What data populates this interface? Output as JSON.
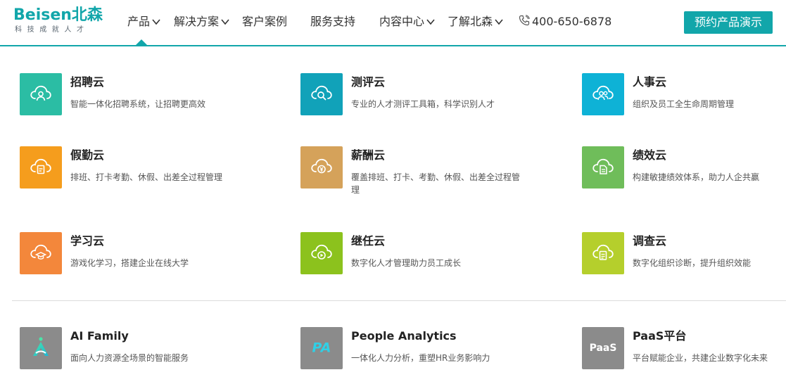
{
  "brand": {
    "logo_word": "Beisen北森",
    "logo_tagline": "科技成就人才",
    "accent_color": "#12a6aa"
  },
  "nav": {
    "items": [
      {
        "label": "产品",
        "dropdown": true
      },
      {
        "label": "解决方案",
        "dropdown": true
      },
      {
        "label": "客户案例",
        "dropdown": false
      },
      {
        "label": "服务支持",
        "dropdown": false
      },
      {
        "label": "内容中心",
        "dropdown": true
      },
      {
        "label": "了解北森",
        "dropdown": true
      }
    ],
    "phone": "400-650-6878",
    "phone_icon": "phone-icon",
    "demo_button": "预约产品演示"
  },
  "products": [
    {
      "name": "招聘云",
      "desc": "智能一体化招聘系统，让招聘更高效",
      "color": "#2bbda4",
      "icon": "cloud-person-icon"
    },
    {
      "name": "测评云",
      "desc": "专业的人才测评工具箱，科学识别人才",
      "color": "#11a2b9",
      "icon": "cloud-search-icon"
    },
    {
      "name": "人事云",
      "desc": "组织及员工全生命周期管理",
      "color": "#0eb2d6",
      "icon": "cloud-people-icon"
    },
    {
      "name": "假勤云",
      "desc": "排班、打卡考勤、休假、出差全过程管理",
      "color": "#f59d1d",
      "icon": "cloud-clipboard-icon"
    },
    {
      "name": "薪酬云",
      "desc": "覆盖排班、打卡、考勤、休假、出差全过程管理",
      "color": "#d5a25a",
      "icon": "cloud-coin-icon"
    },
    {
      "name": "绩效云",
      "desc": "构建敏捷绩效体系，助力人企共赢",
      "color": "#6fbd5a",
      "icon": "cloud-document-icon"
    },
    {
      "name": "学习云",
      "desc": "游戏化学习，搭建企业在线大学",
      "color": "#f3873b",
      "icon": "cloud-graduation-icon"
    },
    {
      "name": "继任云",
      "desc": "数字化人才管理助力员工成长",
      "color": "#8cc21d",
      "icon": "cloud-play-icon"
    },
    {
      "name": "调查云",
      "desc": "数字化组织诊断，提升组织效能",
      "color": "#b5cf2c",
      "icon": "cloud-survey-icon"
    }
  ],
  "platforms": [
    {
      "name": "AI Family",
      "desc": "面向人力资源全场景的智能服务",
      "color": "#8b8b8b",
      "icon": "ai-family-logo-icon"
    },
    {
      "name": "People Analytics",
      "desc": "一体化人力分析，重塑HR业务影响力",
      "color": "#8b8b8b",
      "icon": "pa-logo-icon",
      "logo_text": "PA"
    },
    {
      "name": "PaaS平台",
      "desc": "平台赋能企业，共建企业数字化未来",
      "color": "#8b8b8b",
      "icon": "paas-logo-icon",
      "logo_text": "PaaS"
    }
  ]
}
